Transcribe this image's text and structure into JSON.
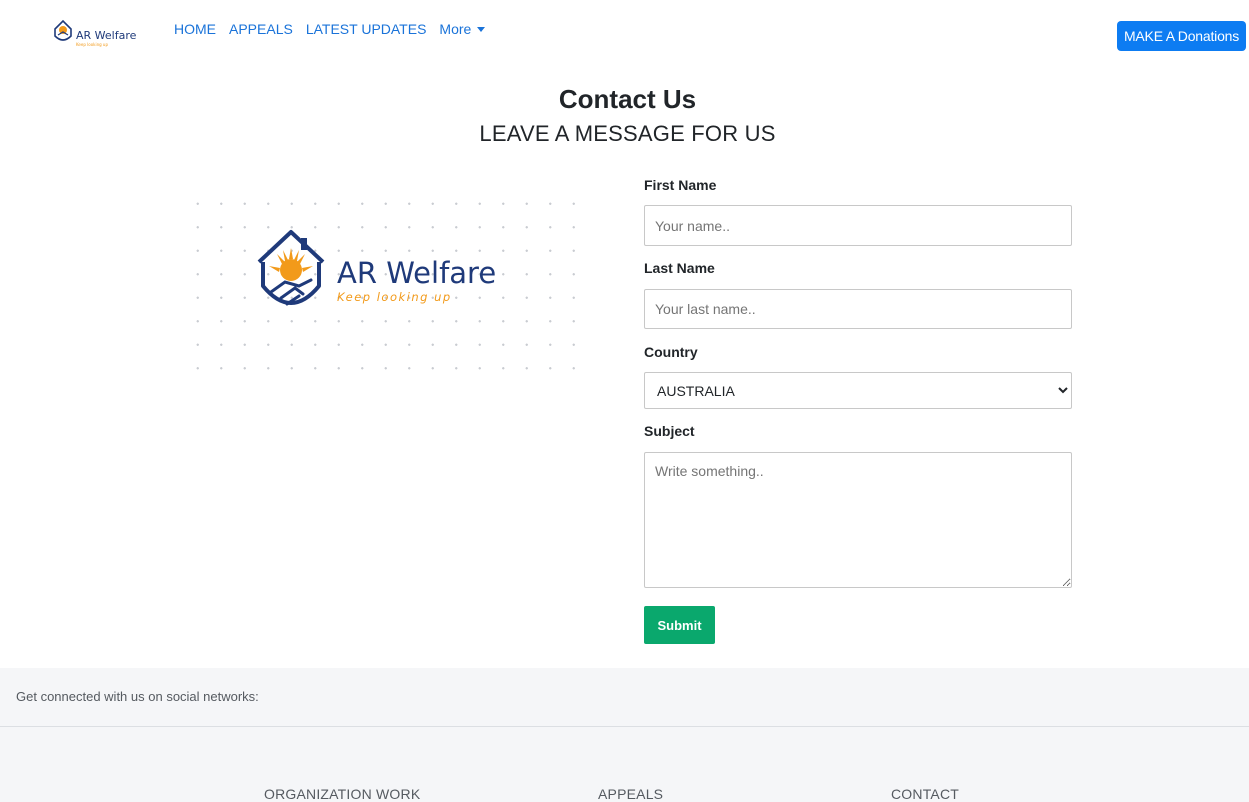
{
  "nav": {
    "logo_text": "AR Welfare",
    "links": [
      "HOME",
      "APPEALS",
      "LATEST UPDATES"
    ],
    "more_label": "More",
    "donate_label": "MAKE A Donations"
  },
  "header": {
    "title": "Contact Us",
    "subtitle": "LEAVE A MESSAGE FOR US"
  },
  "brand": {
    "name": "AR Welfare",
    "tagline": "Keep looking up",
    "primary_color": "#1f3a7a",
    "accent_color": "#f29a1a"
  },
  "form": {
    "first_name_label": "First Name",
    "first_name_placeholder": "Your name..",
    "last_name_label": "Last Name",
    "last_name_placeholder": "Your last name..",
    "country_label": "Country",
    "country_value": "AUSTRALIA",
    "subject_label": "Subject",
    "subject_placeholder": "Write something..",
    "submit_label": "Submit"
  },
  "footer": {
    "social_text": "Get connected with us on social networks:",
    "columns": [
      "ORGANIZATION WORK",
      "APPEALS",
      "CONTACT"
    ]
  }
}
